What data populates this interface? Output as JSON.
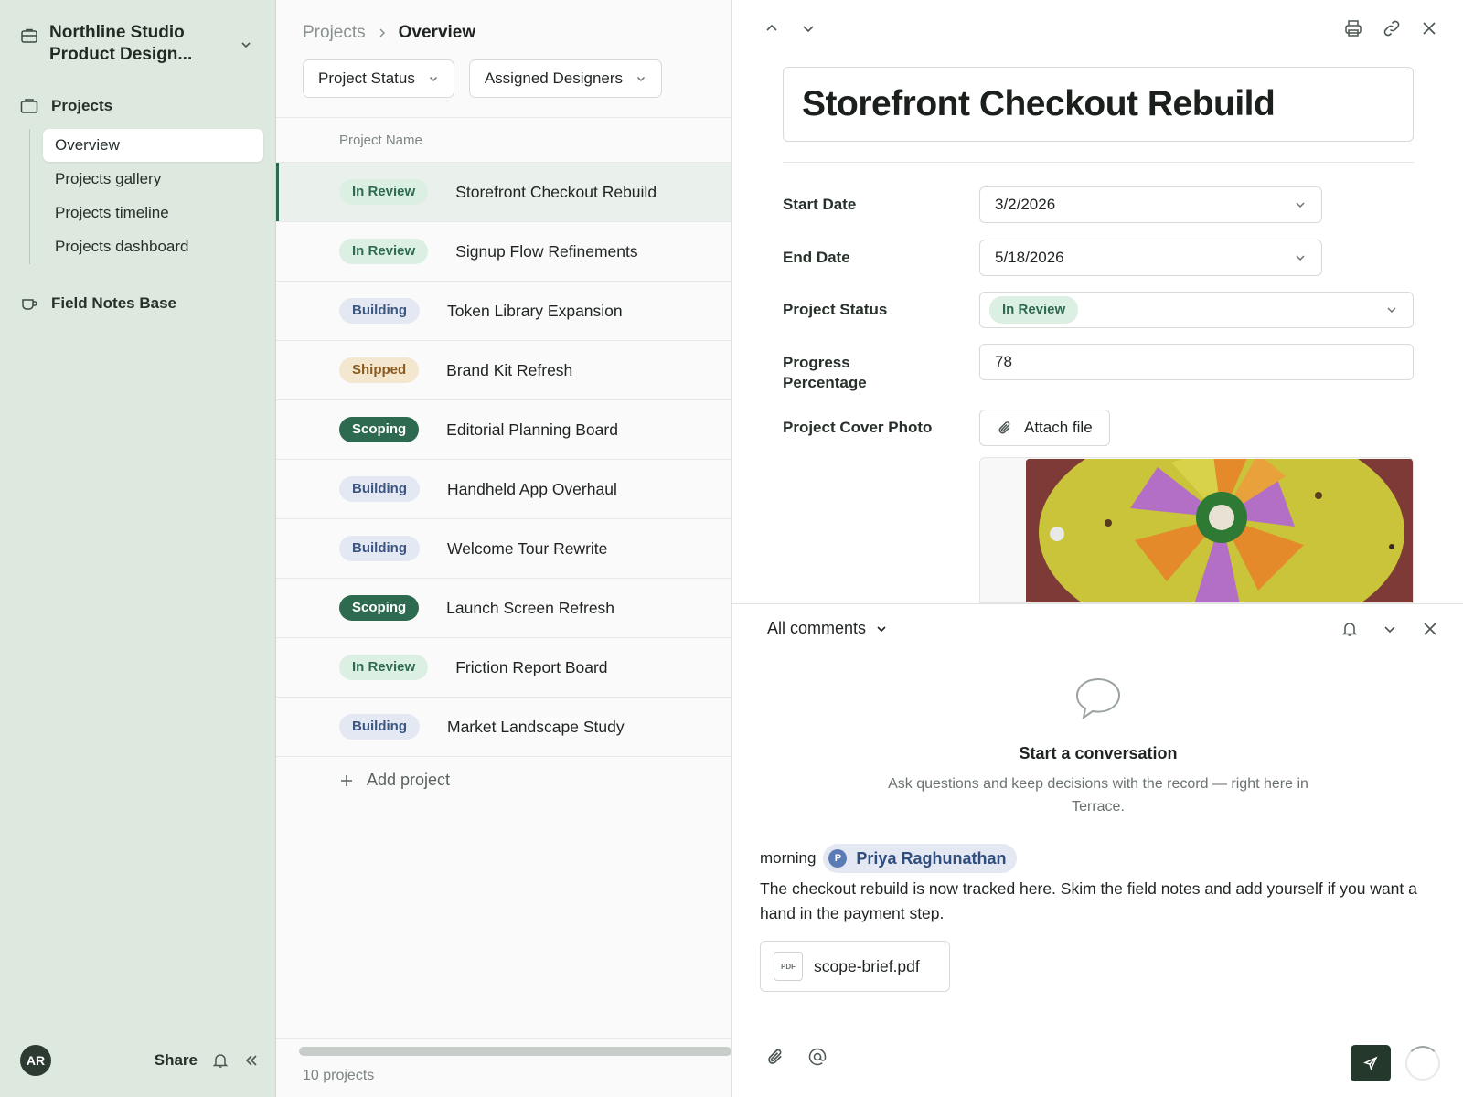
{
  "sidebar": {
    "workspace_name": "Northline Studio Product Design...",
    "section_label": "Projects",
    "items": [
      {
        "label": "Overview",
        "active": true
      },
      {
        "label": "Projects gallery"
      },
      {
        "label": "Projects timeline"
      },
      {
        "label": "Projects dashboard"
      }
    ],
    "section2_label": "Field Notes Base",
    "footer": {
      "avatar_initials": "AR",
      "share_label": "Share"
    }
  },
  "main": {
    "breadcrumb": {
      "parent": "Projects",
      "current": "Overview"
    },
    "filters": [
      "Project Status",
      "Assigned Designers"
    ],
    "column_header": "Project Name",
    "rows": [
      {
        "status": "In Review",
        "name": "Storefront Checkout Rebuild"
      },
      {
        "status": "In Review",
        "name": "Signup Flow Refinements"
      },
      {
        "status": "Building",
        "name": "Token Library Expansion"
      },
      {
        "status": "Shipped",
        "name": "Brand Kit Refresh"
      },
      {
        "status": "Scoping",
        "name": "Editorial Planning Board"
      },
      {
        "status": "Building",
        "name": "Handheld App Overhaul"
      },
      {
        "status": "Building",
        "name": "Welcome Tour Rewrite"
      },
      {
        "status": "Scoping",
        "name": "Launch Screen Refresh"
      },
      {
        "status": "In Review",
        "name": "Friction Report Board"
      },
      {
        "status": "Building",
        "name": "Market Landscape Study"
      }
    ],
    "add_label": "Add project",
    "count_label": "10 projects"
  },
  "detail": {
    "title": "Storefront Checkout Rebuild",
    "fields": {
      "start_date_label": "Start Date",
      "start_date": "3/2/2026",
      "end_date_label": "End Date",
      "end_date": "5/18/2026",
      "status_label": "Project Status",
      "status": "In Review",
      "progress_label": "Progress Percentage",
      "progress": "78",
      "cover_label": "Project Cover Photo",
      "attach_label": "Attach file"
    }
  },
  "comments": {
    "filter_label": "All comments",
    "empty_title": "Start a conversation",
    "empty_text": "Ask questions and keep decisions with the record — right here in Terrace.",
    "message": {
      "time": "morning",
      "mention_initial": "P",
      "mention_name": "Priya Raghunathan",
      "body": "The checkout rebuild is now tracked here. Skim the field notes and add yourself if you want a hand in the payment step.",
      "attachment": "scope-brief.pdf",
      "attachment_type": "PDF"
    }
  },
  "colors": {
    "sidebar_bg": "#dde8df",
    "accent": "#2d6a4f",
    "send_button": "#24392c"
  }
}
